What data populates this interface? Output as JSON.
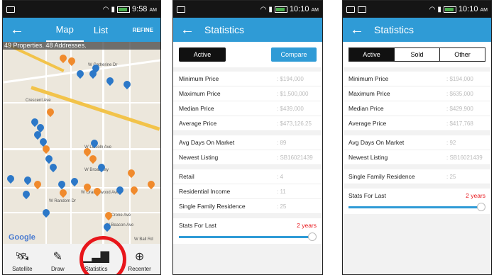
{
  "status": {
    "time1": "9:58",
    "ampm1": "AM",
    "time2": "10:10",
    "ampm2": "AM",
    "time3": "10:10",
    "ampm3": "AM"
  },
  "map_screen": {
    "tabs": [
      "Map",
      "List"
    ],
    "refine": "REFINE",
    "properties_bar": "49 Properties. 48 Addresses.",
    "streets": [
      "W Catherine Dr",
      "Crescent Ave",
      "W Lincoln Ave",
      "W Broadway",
      "W Orangewood Ave",
      "W Crone Ave",
      "W Beacon Ave",
      "W Ball Rd",
      "W Random Dr"
    ],
    "google": "Google",
    "toolbar": [
      "Satellite",
      "Draw",
      "Statistics",
      "Recenter"
    ]
  },
  "stats1": {
    "title": "Statistics",
    "active_label": "Active",
    "compare_label": "Compare",
    "group1": [
      {
        "label": "Minimum Price",
        "value": ": $194,000"
      },
      {
        "label": "Maximum Price",
        "value": ": $1,500,000"
      },
      {
        "label": "Median Price",
        "value": ": $439,000"
      },
      {
        "label": "Average Price",
        "value": ": $473,126.25"
      }
    ],
    "group2": [
      {
        "label": "Avg Days On Market",
        "value": ": 89"
      },
      {
        "label": "Newest Listing",
        "value": ": SB16021439"
      }
    ],
    "group3": [
      {
        "label": "Retail",
        "value": ": 4"
      },
      {
        "label": "Residential Income",
        "value": ": 11"
      },
      {
        "label": "Single Family Residence",
        "value": ": 25"
      }
    ],
    "stats_for_last": "Stats For Last",
    "years": "2 years"
  },
  "stats2": {
    "title": "Statistics",
    "segments": [
      "Active",
      "Sold",
      "Other"
    ],
    "group1": [
      {
        "label": "Minimum Price",
        "value": ": $194,000"
      },
      {
        "label": "Maximum Price",
        "value": ": $635,000"
      },
      {
        "label": "Median Price",
        "value": ": $429,900"
      },
      {
        "label": "Average Price",
        "value": ": $417,768"
      }
    ],
    "group2": [
      {
        "label": "Avg Days On Market",
        "value": ": 92"
      },
      {
        "label": "Newest Listing",
        "value": ": SB16021439"
      }
    ],
    "group3": [
      {
        "label": "Single Family Residence",
        "value": ": 25"
      }
    ],
    "stats_for_last": "Stats For Last",
    "years": "2 years"
  },
  "colors": {
    "accent": "#2f9bd6",
    "highlight": "#e8161b",
    "pin_orange": "#f08a2c",
    "pin_blue": "#2c78c8"
  }
}
